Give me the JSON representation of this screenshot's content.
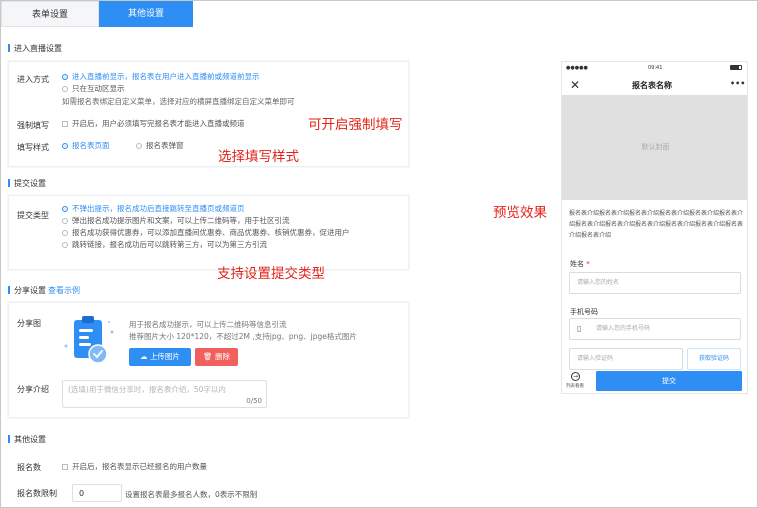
{
  "tabs": [
    "表单设置",
    "其他设置"
  ],
  "live": {
    "section_title": "进入直播设置",
    "entry_label": "进入方式",
    "entry_opt1": "进入直播前显示，报名表在用户进入直播前或频道前显示",
    "entry_opt2": "只在互动区显示",
    "entry_note": "如需报名表绑定自定义菜单，选择对应的横屏直播绑定自定义菜单即可",
    "force_label": "强制填写",
    "force_text": "开启后，用户必须填写完报名表才能进入直播或频道",
    "style_label": "填写样式",
    "style_opt1": "报名表页面",
    "style_opt2": "报名表弹窗"
  },
  "submit": {
    "section_title": "提交设置",
    "type_label": "提交类型",
    "opt1": "不弹出提示，报名成功后直接跳转至直播页或频道页",
    "opt2": "弹出报名成功提示图片和文案，可以上传二维码等，用于社区引流",
    "opt3": "报名成功获得优惠券，可以添加直播间优惠券、商品优惠券、核销优惠券，促进用户",
    "opt4": "跳转链接，报名成功后可以跳转第三方，可以为第三方引流"
  },
  "share": {
    "section_title": "分享设置",
    "example_link": "查看示例",
    "image_label": "分享图",
    "hint1": "用于报名成功提示，可以上传二维码等信息引流",
    "hint2": "推荐图片大小 120*120，不超过2M ,支持jpg、png、jpge格式图片",
    "upload_btn": "上传图片",
    "delete_btn": "删除",
    "intro_label": "分享介绍",
    "intro_placeholder": "(选填)用于微信分享时，报名表介绍，50字以内",
    "intro_count": "0/50"
  },
  "other": {
    "section_title": "其他设置",
    "count_label": "报名数",
    "count_text": "开启后，报名表显示已经报名的用户数量",
    "limit_label": "报名数限制",
    "limit_value": "0",
    "limit_hint": "设置报名表最多报名人数，0表示不限制"
  },
  "annotations": {
    "force": "可开启强制填写",
    "style": "选择填写样式",
    "submit": "支持设置提交类型",
    "preview": "预览效果"
  },
  "phone": {
    "signal": "●●●●●",
    "time": "09:41",
    "title": "报名表名称",
    "more": "•••",
    "cover": "默认封面",
    "desc": "报名表介绍报名表介绍报名表介绍报名表介绍报名表介绍报名表介绍报名表介绍报名表介绍报名表介绍报名表介绍报名表介绍报名表介绍报名表介绍",
    "name_label": "姓名",
    "required": "*",
    "name_placeholder": "请输入您的姓名",
    "phone_label": "手机号码",
    "phone_placeholder": "请输入您的手机号码",
    "code_placeholder": "请输入验证码",
    "code_btn": "获取验证码",
    "side_label": "列表看看",
    "submit_btn": "提交"
  },
  "colors": {
    "accent": "#2f8ef3",
    "danger": "#f0605d",
    "annotation": "#e2231a"
  },
  "icons": [
    "close-icon",
    "cloud-upload-icon",
    "trash-icon",
    "phone-icon",
    "arrow-circle-icon",
    "clipboard-check-icon"
  ]
}
